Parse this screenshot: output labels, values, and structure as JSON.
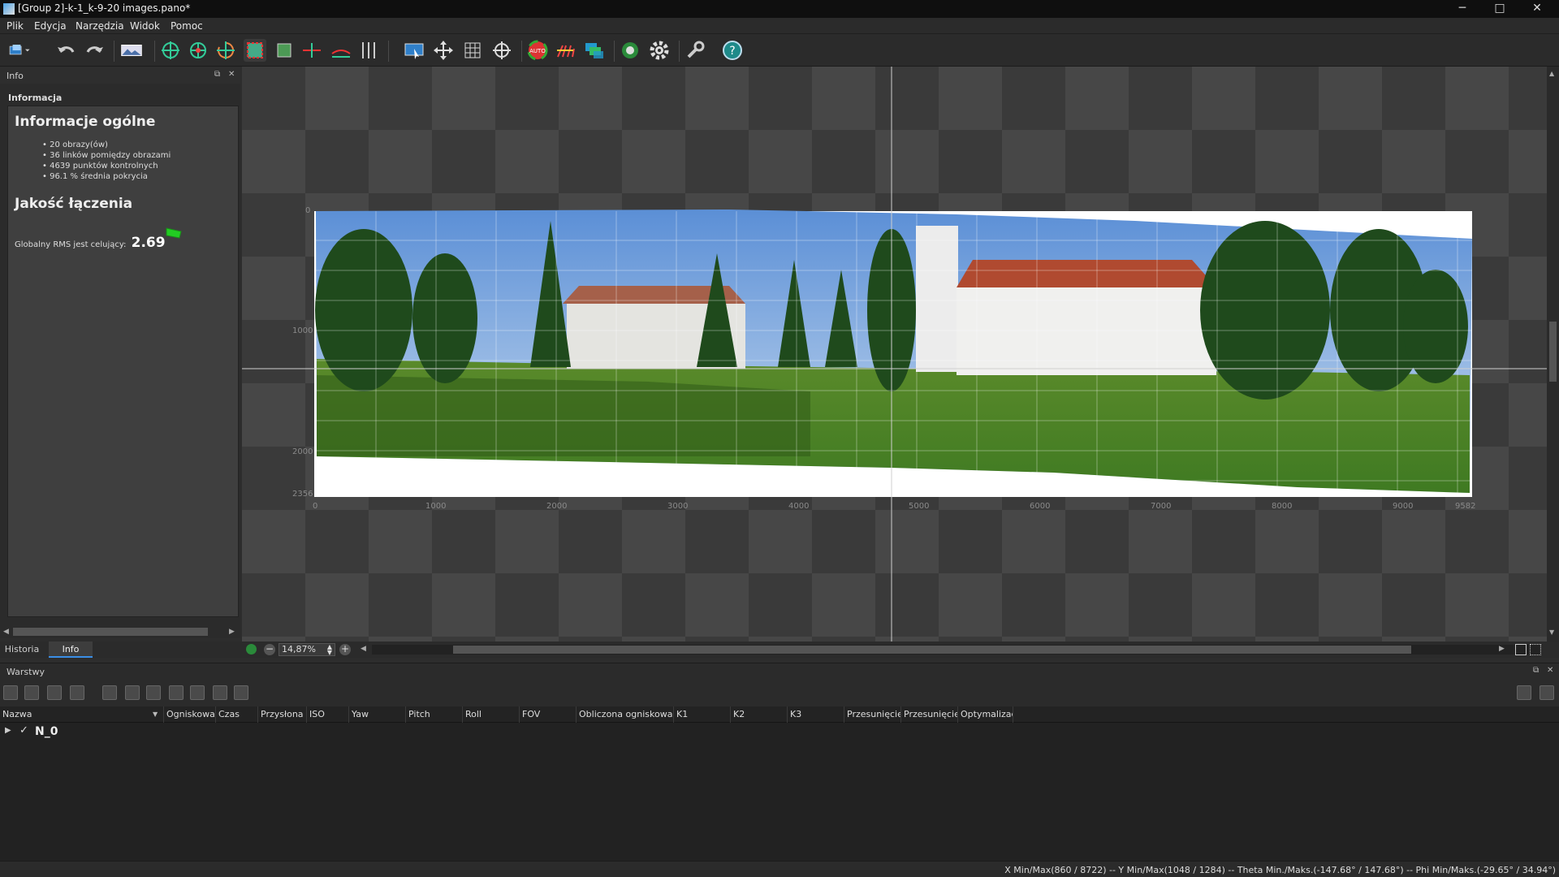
{
  "window": {
    "title": "[Group 2]-k-1_k-9-20 images.pano*",
    "minimize": "─",
    "maximize": "□",
    "close": "✕"
  },
  "menu": [
    "Plik",
    "Edycja",
    "Narzędzia",
    "Widok",
    "Pomoc"
  ],
  "toolbar_icons": [
    "new-project-icon",
    "undo-icon",
    "redo-icon",
    "panorama-icon",
    "add-point-icon",
    "move-point-icon",
    "rotate-point-icon",
    "crop-icon",
    "mask-icon",
    "horizon-line-icon",
    "straighten-icon",
    "vertical-lines-icon",
    "select-image-icon",
    "pan-icon",
    "grid-icon",
    "center-icon",
    "auto-icon",
    "color-correction-icon",
    "layers-icon",
    "render-icon",
    "settings-icon",
    "tools-icon",
    "help-icon"
  ],
  "info_panel": {
    "title": "Info",
    "section": "Informacja",
    "general_heading": "Informacje ogólne",
    "general_items": [
      "20 obrazy(ów)",
      "36 linków pomiędzy obrazami",
      "4639 punktów kontrolnych",
      "96.1 % średnia pokrycia"
    ],
    "quality_heading": "Jakość łączenia",
    "rms_label": "Globalny RMS jest celujący:",
    "rms_value": "2.69",
    "rms_status_color": "#22cc22"
  },
  "left_tabs": [
    "Historia",
    "Info"
  ],
  "canvas": {
    "x_ticks": [
      "0",
      "1000",
      "2000",
      "3000",
      "4000",
      "5000",
      "6000",
      "7000",
      "8000",
      "9000",
      "9582"
    ],
    "y_ticks": [
      "0",
      "1000",
      "2000",
      "2356"
    ]
  },
  "zoom": {
    "value": "14,87%"
  },
  "layers": {
    "title": "Warstwy",
    "columns": [
      "Nazwa",
      "Ogniskowa",
      "Czas",
      "Przysłona",
      "ISO",
      "Yaw",
      "Pitch",
      "Roll",
      "FOV",
      "Obliczona ogniskowa",
      "K1",
      "K2",
      "K3",
      "Przesunięcie",
      "Przesunięcie",
      "Optymalizac"
    ],
    "rows": [
      {
        "name": "N_0",
        "checked": "✓",
        "expander": "▶"
      }
    ]
  },
  "status": {
    "text": "X Min/Max(860 / 8722)  --  Y Min/Max(1048 / 1284)  --  Theta Min./Maks.(-147.68° / 147.68°)  --  Phi Min/Maks.(-29.65° / 34.94°)"
  }
}
